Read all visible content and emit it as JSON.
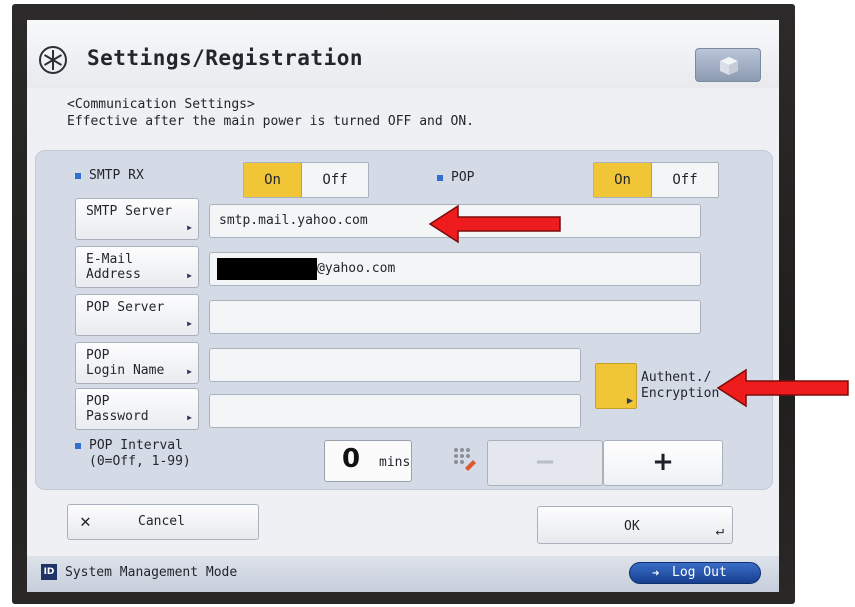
{
  "window": {
    "title": "Settings/Registration"
  },
  "header": {
    "section": "<Communication Settings>",
    "note": "Effective after the main power is turned OFF and ON."
  },
  "smtp_rx": {
    "label": "SMTP RX",
    "on_label": "On",
    "off_label": "Off",
    "selected": "On"
  },
  "pop": {
    "label": "POP",
    "on_label": "On",
    "off_label": "Off",
    "selected": "On"
  },
  "fields": {
    "smtp_server": {
      "label": "SMTP Server",
      "value": "smtp.mail.yahoo.com"
    },
    "email_address": {
      "label_line1": "E-Mail",
      "label_line2": "Address",
      "value_suffix": "@yahoo.com"
    },
    "pop_server": {
      "label": "POP Server",
      "value": ""
    },
    "pop_login": {
      "label_line1": "POP",
      "label_line2": "Login Name",
      "value": ""
    },
    "pop_password": {
      "label_line1": "POP",
      "label_line2": "Password",
      "value": ""
    }
  },
  "auth": {
    "label_line1": "Authent./",
    "label_line2": "Encryption"
  },
  "pop_interval": {
    "label_line1": "POP Interval",
    "label_line2": "(0=Off, 1-99)",
    "value": "0",
    "unit": "mins",
    "minus": "−",
    "plus": "+"
  },
  "actions": {
    "cancel": "Cancel",
    "ok": "OK"
  },
  "status": {
    "mode": "System Management Mode",
    "badge": "ID",
    "logout": "Log Out"
  },
  "colors": {
    "accent_yellow": "#f0c637",
    "status_blue": "#1e3366",
    "annotation_red": "#ee1c1c"
  },
  "icons": {
    "title": "settings-star-icon",
    "cube": "cube-icon",
    "keypad": "keypad-icon",
    "enter": "enter-icon",
    "logout": "logout-icon"
  }
}
